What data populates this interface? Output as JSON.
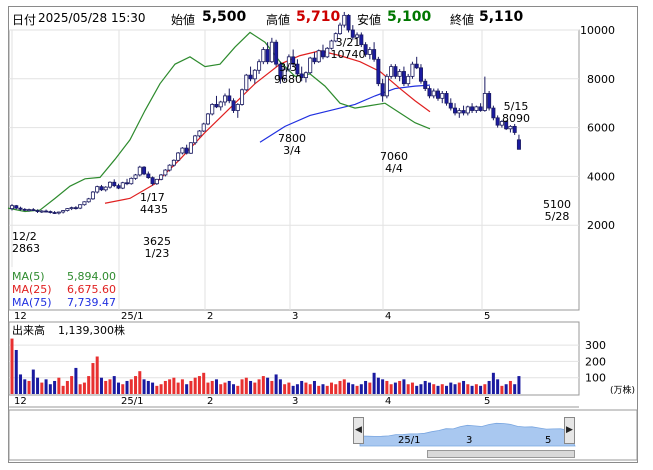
{
  "header": {
    "date_label": "日付",
    "date": "2025/05/28 15:30",
    "open_label": "始値",
    "open": "5,500",
    "high_label": "高値",
    "high": "5,710",
    "low_label": "安値",
    "low": "5,100",
    "close_label": "終値",
    "close": "5,110"
  },
  "colors": {
    "high": "#cc0000",
    "low": "#007700",
    "ma5": "#2e8b2e",
    "ma25": "#e02020",
    "ma75": "#2030e0",
    "candle_up": "#ffffff",
    "candle_down": "#1a1aa0",
    "vol_up": "#e83030",
    "vol_down": "#1a1aa0",
    "nav_fill": "#a9c8f0"
  },
  "legend": [
    {
      "label": "MA(5)",
      "value": "5,894.00"
    },
    {
      "label": "MA(25)",
      "value": "6,675.60"
    },
    {
      "label": "MA(75)",
      "value": "7,739.47"
    }
  ],
  "price_axis": {
    "ticks": [
      "10000",
      "8000",
      "6000",
      "4000",
      "2000"
    ]
  },
  "x_axis": {
    "labels": [
      "12",
      "25/1",
      "2",
      "3",
      "4",
      "5"
    ]
  },
  "annotations": [
    {
      "date": "12/2",
      "price": "2863"
    },
    {
      "date": "1/17",
      "price": "4435"
    },
    {
      "price": "3625",
      "date": "1/23"
    },
    {
      "date": "3/3",
      "price": "9680"
    },
    {
      "price": "7800",
      "date": "3/4"
    },
    {
      "date": "3/21",
      "price": "10740"
    },
    {
      "price": "7060",
      "date": "4/4"
    },
    {
      "date": "5/15",
      "price": "8090"
    },
    {
      "price": "5100",
      "date": "5/28"
    }
  ],
  "volume": {
    "title": "出来高",
    "value": "1,139,300株",
    "ticks": [
      "300",
      "200",
      "100"
    ],
    "unit": "(万株)"
  },
  "navigator": {
    "labels": [
      "25/1",
      "3",
      "5"
    ],
    "left_button": "◀",
    "right_button": "▶"
  },
  "chart_data": {
    "type": "candlestick",
    "ylim": [
      0,
      11000
    ],
    "candles": [
      [
        2680,
        2863,
        2600,
        2800
      ],
      [
        2800,
        2830,
        2650,
        2700
      ],
      [
        2700,
        2760,
        2600,
        2650
      ],
      [
        2650,
        2700,
        2580,
        2620
      ],
      [
        2620,
        2680,
        2560,
        2640
      ],
      [
        2640,
        2700,
        2580,
        2600
      ],
      [
        2600,
        2650,
        2500,
        2560
      ],
      [
        2560,
        2620,
        2500,
        2580
      ],
      [
        2580,
        2640,
        2520,
        2560
      ],
      [
        2560,
        2600,
        2480,
        2520
      ],
      [
        2520,
        2580,
        2460,
        2500
      ],
      [
        2500,
        2560,
        2440,
        2540
      ],
      [
        2540,
        2620,
        2480,
        2600
      ],
      [
        2600,
        2700,
        2560,
        2680
      ],
      [
        2680,
        2760,
        2620,
        2720
      ],
      [
        2720,
        2780,
        2640,
        2700
      ],
      [
        2700,
        2860,
        2660,
        2840
      ],
      [
        2840,
        2980,
        2800,
        2960
      ],
      [
        2960,
        3120,
        2920,
        3080
      ],
      [
        3080,
        3400,
        3040,
        3360
      ],
      [
        3360,
        3620,
        3300,
        3580
      ],
      [
        3580,
        3650,
        3400,
        3450
      ],
      [
        3450,
        3600,
        3380,
        3560
      ],
      [
        3560,
        3800,
        3500,
        3760
      ],
      [
        3760,
        3880,
        3560,
        3620
      ],
      [
        3620,
        3700,
        3480,
        3520
      ],
      [
        3520,
        3780,
        3480,
        3740
      ],
      [
        3740,
        3900,
        3640,
        3700
      ],
      [
        3700,
        3960,
        3660,
        3920
      ],
      [
        3920,
        4100,
        3860,
        4060
      ],
      [
        4060,
        4435,
        4000,
        4380
      ],
      [
        4380,
        4420,
        4050,
        4100
      ],
      [
        4100,
        4200,
        3900,
        3950
      ],
      [
        3950,
        4000,
        3625,
        3700
      ],
      [
        3700,
        3900,
        3650,
        3880
      ],
      [
        3880,
        4100,
        3840,
        4060
      ],
      [
        4060,
        4300,
        4000,
        4260
      ],
      [
        4260,
        4500,
        4200,
        4460
      ],
      [
        4460,
        4700,
        4400,
        4660
      ],
      [
        4660,
        5000,
        4620,
        4960
      ],
      [
        4960,
        5200,
        4900,
        5160
      ],
      [
        5160,
        5300,
        4900,
        4950
      ],
      [
        4950,
        5400,
        4920,
        5380
      ],
      [
        5380,
        5700,
        5300,
        5660
      ],
      [
        5660,
        5900,
        5600,
        5860
      ],
      [
        5860,
        6200,
        5820,
        6150
      ],
      [
        6150,
        6600,
        6100,
        6560
      ],
      [
        6560,
        7000,
        6500,
        6950
      ],
      [
        6950,
        7300,
        6800,
        6850
      ],
      [
        6850,
        7100,
        6700,
        7050
      ],
      [
        7050,
        7400,
        6900,
        7300
      ],
      [
        7300,
        7600,
        7000,
        7100
      ],
      [
        7100,
        7200,
        6600,
        6700
      ],
      [
        6700,
        7000,
        6400,
        6950
      ],
      [
        6950,
        7600,
        6900,
        7550
      ],
      [
        7550,
        8200,
        7500,
        8150
      ],
      [
        8150,
        8500,
        7900,
        8000
      ],
      [
        8000,
        8400,
        7800,
        8350
      ],
      [
        8350,
        8800,
        8200,
        8700
      ],
      [
        8700,
        9300,
        8600,
        9200
      ],
      [
        9200,
        9500,
        8600,
        8700
      ],
      [
        8700,
        9680,
        8650,
        9500
      ],
      [
        9500,
        9600,
        8500,
        8600
      ],
      [
        8600,
        8700,
        7800,
        8000
      ],
      [
        8000,
        8500,
        7900,
        8400
      ],
      [
        8400,
        9000,
        8300,
        8900
      ],
      [
        8900,
        9200,
        8500,
        8600
      ],
      [
        8600,
        8800,
        8100,
        8200
      ],
      [
        8200,
        8500,
        7900,
        8050
      ],
      [
        8050,
        8300,
        7850,
        8250
      ],
      [
        8250,
        8900,
        8200,
        8850
      ],
      [
        8850,
        9100,
        8600,
        8700
      ],
      [
        8700,
        9200,
        8650,
        9150
      ],
      [
        9150,
        9400,
        8800,
        8900
      ],
      [
        8900,
        9300,
        8850,
        9250
      ],
      [
        9250,
        9600,
        9200,
        9550
      ],
      [
        9550,
        9900,
        9500,
        9850
      ],
      [
        9850,
        10300,
        9800,
        10200
      ],
      [
        10200,
        10740,
        10100,
        10600
      ],
      [
        10600,
        10650,
        9900,
        10000
      ],
      [
        10000,
        10200,
        9600,
        9700
      ],
      [
        9700,
        9900,
        9400,
        9800
      ],
      [
        9800,
        9900,
        9300,
        9400
      ],
      [
        9400,
        9500,
        8900,
        9000
      ],
      [
        9000,
        9300,
        8800,
        9200
      ],
      [
        9200,
        9500,
        8700,
        8800
      ],
      [
        8800,
        8900,
        7700,
        7800
      ],
      [
        7800,
        8000,
        7060,
        7300
      ],
      [
        7300,
        8200,
        7200,
        8100
      ],
      [
        8100,
        8600,
        8000,
        8500
      ],
      [
        8500,
        8600,
        8000,
        8100
      ],
      [
        8100,
        8400,
        7900,
        8300
      ],
      [
        8300,
        8500,
        7700,
        7800
      ],
      [
        7800,
        8200,
        7700,
        8100
      ],
      [
        8100,
        8700,
        8000,
        8600
      ],
      [
        8600,
        8900,
        8400,
        8450
      ],
      [
        8450,
        8600,
        7800,
        7900
      ],
      [
        7900,
        8000,
        7500,
        7600
      ],
      [
        7600,
        7700,
        7200,
        7300
      ],
      [
        7300,
        7600,
        7200,
        7500
      ],
      [
        7500,
        7600,
        7100,
        7200
      ],
      [
        7200,
        7500,
        7000,
        7400
      ],
      [
        7400,
        7500,
        6900,
        7000
      ],
      [
        7000,
        7200,
        6700,
        6800
      ],
      [
        6800,
        7000,
        6500,
        6600
      ],
      [
        6600,
        6800,
        6400,
        6700
      ],
      [
        6700,
        6900,
        6500,
        6600
      ],
      [
        6600,
        6900,
        6500,
        6850
      ],
      [
        6850,
        7000,
        6600,
        6700
      ],
      [
        6700,
        6900,
        6600,
        6850
      ],
      [
        6850,
        7000,
        6650,
        6700
      ],
      [
        6700,
        8090,
        6650,
        7400
      ],
      [
        7400,
        7500,
        6700,
        6800
      ],
      [
        6800,
        6900,
        6300,
        6400
      ],
      [
        6400,
        6500,
        6000,
        6100
      ],
      [
        6100,
        6300,
        6000,
        6250
      ],
      [
        6250,
        6300,
        5900,
        5950
      ],
      [
        5950,
        6100,
        5800,
        6050
      ],
      [
        6050,
        6150,
        5700,
        5800
      ],
      [
        5500,
        5710,
        5100,
        5110
      ]
    ],
    "volume": [
      340,
      270,
      120,
      90,
      80,
      150,
      100,
      70,
      90,
      60,
      80,
      100,
      50,
      80,
      110,
      160,
      60,
      70,
      110,
      190,
      230,
      100,
      80,
      90,
      110,
      70,
      60,
      80,
      90,
      110,
      140,
      90,
      80,
      70,
      50,
      60,
      80,
      90,
      100,
      70,
      90,
      60,
      80,
      100,
      110,
      130,
      70,
      80,
      90,
      60,
      70,
      80,
      60,
      50,
      90,
      100,
      80,
      70,
      90,
      110,
      100,
      80,
      120,
      90,
      60,
      70,
      50,
      60,
      80,
      70,
      60,
      80,
      50,
      60,
      50,
      70,
      60,
      80,
      90,
      70,
      60,
      50,
      60,
      80,
      70,
      130,
      100,
      90,
      80,
      60,
      70,
      80,
      90,
      60,
      70,
      50,
      60,
      80,
      70,
      60,
      50,
      60,
      50,
      70,
      60,
      70,
      80,
      60,
      50,
      60,
      50,
      60,
      80,
      130,
      90,
      50,
      60,
      80,
      60,
      110
    ],
    "ma5": [
      [
        8,
        2700
      ],
      [
        25,
        2560
      ],
      [
        40,
        2620
      ],
      [
        55,
        3100
      ],
      [
        70,
        3600
      ],
      [
        85,
        3900
      ],
      [
        100,
        3960
      ],
      [
        115,
        4700
      ],
      [
        130,
        5500
      ],
      [
        145,
        6700
      ],
      [
        160,
        7800
      ],
      [
        175,
        8600
      ],
      [
        190,
        8900
      ],
      [
        205,
        8500
      ],
      [
        220,
        8600
      ],
      [
        235,
        9300
      ],
      [
        250,
        9900
      ],
      [
        265,
        9500
      ],
      [
        280,
        8700
      ],
      [
        295,
        8100
      ],
      [
        310,
        8200
      ],
      [
        325,
        7700
      ],
      [
        340,
        7000
      ],
      [
        355,
        6800
      ],
      [
        370,
        6900
      ],
      [
        385,
        7000
      ],
      [
        400,
        6600
      ],
      [
        415,
        6200
      ],
      [
        430,
        5950
      ]
    ],
    "ma25": [
      [
        105,
        2900
      ],
      [
        130,
        3100
      ],
      [
        155,
        3700
      ],
      [
        180,
        4700
      ],
      [
        205,
        5800
      ],
      [
        230,
        6800
      ],
      [
        255,
        7800
      ],
      [
        280,
        8600
      ],
      [
        300,
        8950
      ],
      [
        320,
        9150
      ],
      [
        340,
        8950
      ],
      [
        360,
        8700
      ],
      [
        380,
        8300
      ],
      [
        400,
        7600
      ],
      [
        415,
        7100
      ],
      [
        430,
        6650
      ]
    ],
    "ma75": [
      [
        260,
        5400
      ],
      [
        285,
        6050
      ],
      [
        310,
        6500
      ],
      [
        335,
        6750
      ],
      [
        355,
        6950
      ],
      [
        375,
        7300
      ],
      [
        395,
        7600
      ],
      [
        415,
        7700
      ],
      [
        430,
        7740
      ]
    ]
  }
}
